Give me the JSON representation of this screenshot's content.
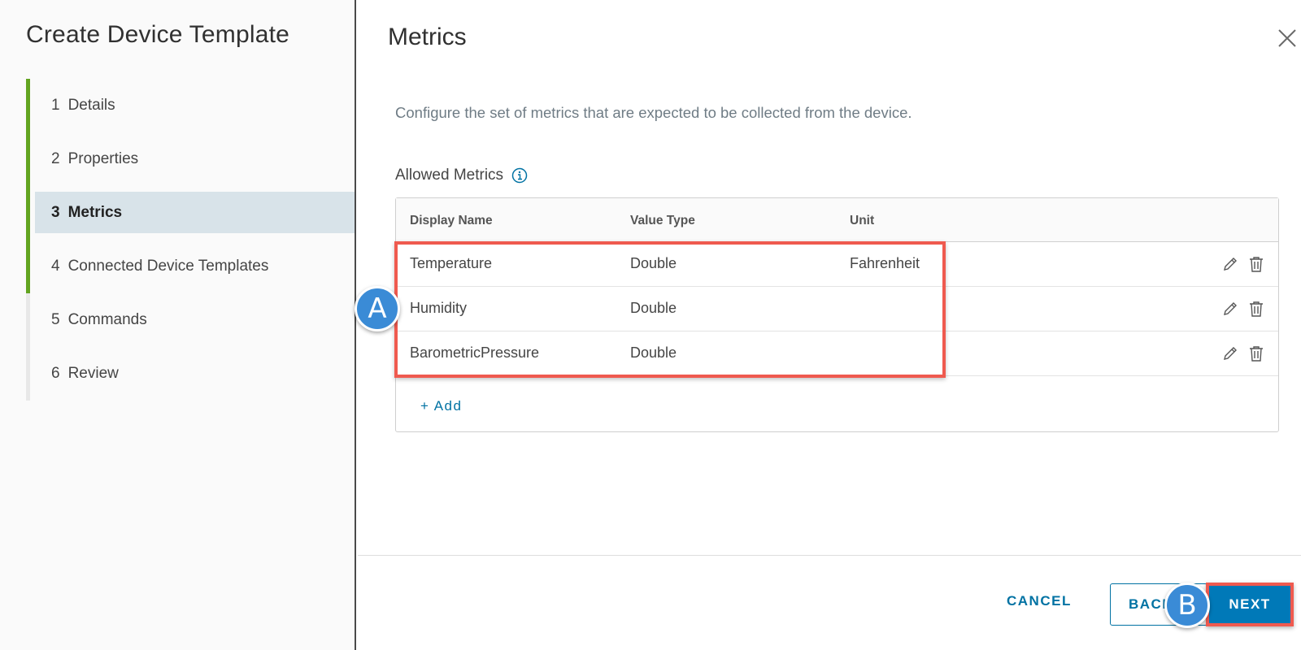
{
  "sidebar": {
    "title": "Create Device Template",
    "steps": [
      {
        "num": "1",
        "label": "Details"
      },
      {
        "num": "2",
        "label": "Properties"
      },
      {
        "num": "3",
        "label": "Metrics"
      },
      {
        "num": "4",
        "label": "Connected Device Templates"
      },
      {
        "num": "5",
        "label": "Commands"
      },
      {
        "num": "6",
        "label": "Review"
      }
    ]
  },
  "main": {
    "title": "Metrics",
    "description": "Configure the set of metrics that are expected to be collected from the device.",
    "section_label": "Allowed Metrics",
    "table": {
      "headers": [
        "Display Name",
        "Value Type",
        "Unit"
      ],
      "rows": [
        {
          "name": "Temperature",
          "type": "Double",
          "unit": "Fahrenheit"
        },
        {
          "name": "Humidity",
          "type": "Double",
          "unit": ""
        },
        {
          "name": "BarometricPressure",
          "type": "Double",
          "unit": ""
        }
      ],
      "add_label": "+ Add"
    }
  },
  "footer": {
    "cancel_label": "CANCEL",
    "back_label": "BACK",
    "next_label": "NEXT"
  },
  "annotations": {
    "a": "A",
    "b": "B"
  },
  "colors": {
    "accent": "#0079b8",
    "step_done": "#62a420",
    "highlight": "#ef5a4f",
    "badge": "#3a8bd6"
  }
}
